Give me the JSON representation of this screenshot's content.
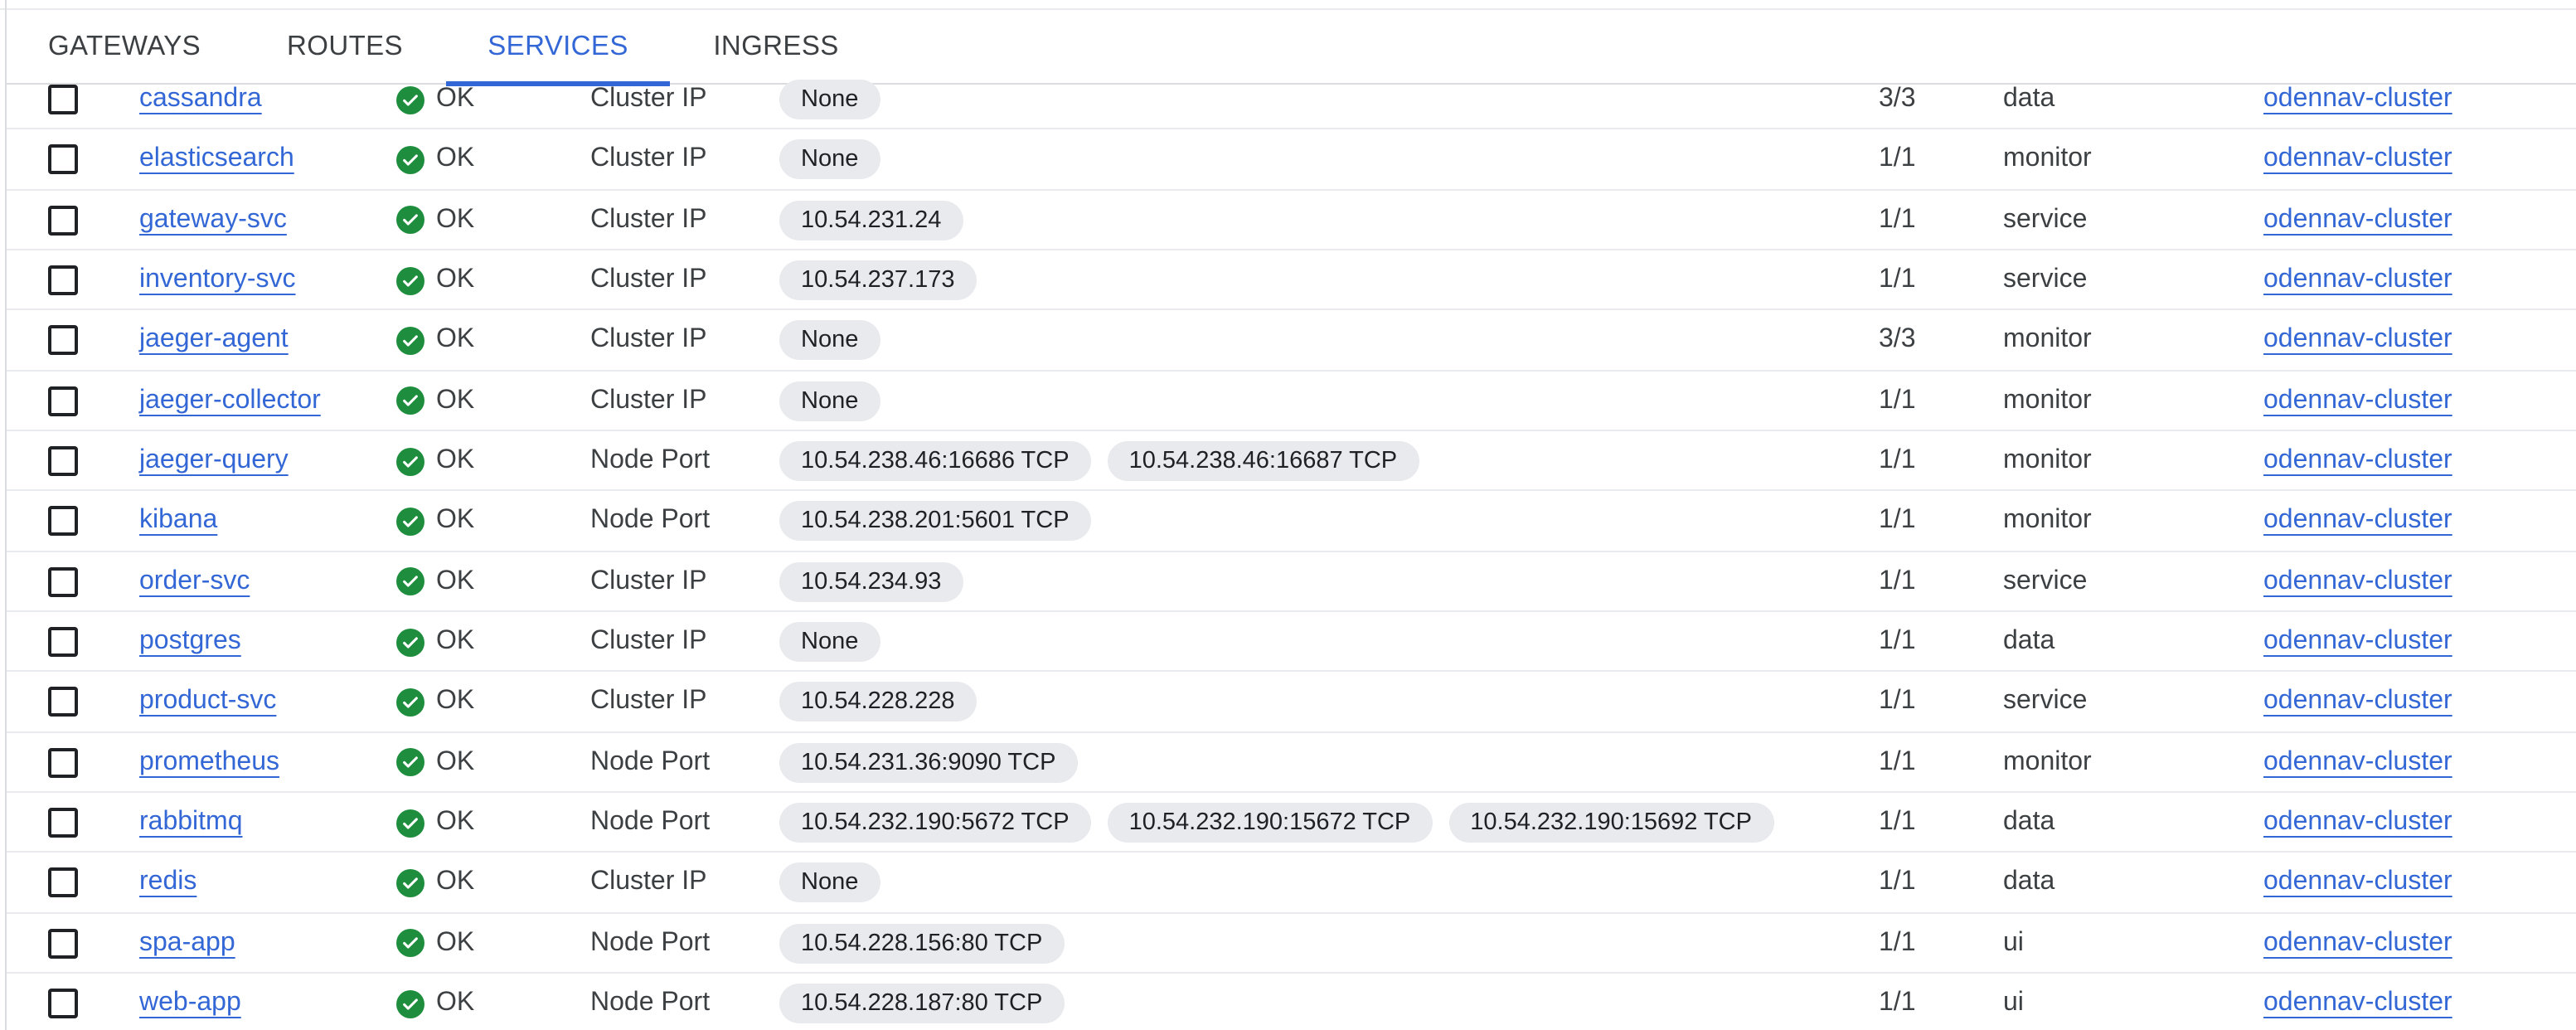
{
  "tabs": [
    {
      "label": "GATEWAYS",
      "active": false
    },
    {
      "label": "ROUTES",
      "active": false
    },
    {
      "label": "SERVICES",
      "active": true
    },
    {
      "label": "INGRESS",
      "active": false
    }
  ],
  "colors": {
    "accent": "#3367d6",
    "ok_green": "#1e8e3e",
    "chip_bg": "#e8eaed"
  },
  "icons": {
    "status_ok": "check-circle-icon"
  },
  "services": [
    {
      "name": "cassandra",
      "status": "OK",
      "type": "Cluster IP",
      "endpoints": [
        "None"
      ],
      "pods": "3/3",
      "namespace": "data",
      "cluster": "odennav-cluster"
    },
    {
      "name": "elasticsearch",
      "status": "OK",
      "type": "Cluster IP",
      "endpoints": [
        "None"
      ],
      "pods": "1/1",
      "namespace": "monitor",
      "cluster": "odennav-cluster"
    },
    {
      "name": "gateway-svc",
      "status": "OK",
      "type": "Cluster IP",
      "endpoints": [
        "10.54.231.24"
      ],
      "pods": "1/1",
      "namespace": "service",
      "cluster": "odennav-cluster"
    },
    {
      "name": "inventory-svc",
      "status": "OK",
      "type": "Cluster IP",
      "endpoints": [
        "10.54.237.173"
      ],
      "pods": "1/1",
      "namespace": "service",
      "cluster": "odennav-cluster"
    },
    {
      "name": "jaeger-agent",
      "status": "OK",
      "type": "Cluster IP",
      "endpoints": [
        "None"
      ],
      "pods": "3/3",
      "namespace": "monitor",
      "cluster": "odennav-cluster"
    },
    {
      "name": "jaeger-collector",
      "status": "OK",
      "type": "Cluster IP",
      "endpoints": [
        "None"
      ],
      "pods": "1/1",
      "namespace": "monitor",
      "cluster": "odennav-cluster"
    },
    {
      "name": "jaeger-query",
      "status": "OK",
      "type": "Node Port",
      "endpoints": [
        "10.54.238.46:16686 TCP",
        "10.54.238.46:16687 TCP"
      ],
      "pods": "1/1",
      "namespace": "monitor",
      "cluster": "odennav-cluster"
    },
    {
      "name": "kibana",
      "status": "OK",
      "type": "Node Port",
      "endpoints": [
        "10.54.238.201:5601 TCP"
      ],
      "pods": "1/1",
      "namespace": "monitor",
      "cluster": "odennav-cluster"
    },
    {
      "name": "order-svc",
      "status": "OK",
      "type": "Cluster IP",
      "endpoints": [
        "10.54.234.93"
      ],
      "pods": "1/1",
      "namespace": "service",
      "cluster": "odennav-cluster"
    },
    {
      "name": "postgres",
      "status": "OK",
      "type": "Cluster IP",
      "endpoints": [
        "None"
      ],
      "pods": "1/1",
      "namespace": "data",
      "cluster": "odennav-cluster"
    },
    {
      "name": "product-svc",
      "status": "OK",
      "type": "Cluster IP",
      "endpoints": [
        "10.54.228.228"
      ],
      "pods": "1/1",
      "namespace": "service",
      "cluster": "odennav-cluster"
    },
    {
      "name": "prometheus",
      "status": "OK",
      "type": "Node Port",
      "endpoints": [
        "10.54.231.36:9090 TCP"
      ],
      "pods": "1/1",
      "namespace": "monitor",
      "cluster": "odennav-cluster"
    },
    {
      "name": "rabbitmq",
      "status": "OK",
      "type": "Node Port",
      "endpoints": [
        "10.54.232.190:5672 TCP",
        "10.54.232.190:15672 TCP",
        "10.54.232.190:15692 TCP"
      ],
      "pods": "1/1",
      "namespace": "data",
      "cluster": "odennav-cluster"
    },
    {
      "name": "redis",
      "status": "OK",
      "type": "Cluster IP",
      "endpoints": [
        "None"
      ],
      "pods": "1/1",
      "namespace": "data",
      "cluster": "odennav-cluster"
    },
    {
      "name": "spa-app",
      "status": "OK",
      "type": "Node Port",
      "endpoints": [
        "10.54.228.156:80 TCP"
      ],
      "pods": "1/1",
      "namespace": "ui",
      "cluster": "odennav-cluster"
    },
    {
      "name": "web-app",
      "status": "OK",
      "type": "Node Port",
      "endpoints": [
        "10.54.228.187:80 TCP"
      ],
      "pods": "1/1",
      "namespace": "ui",
      "cluster": "odennav-cluster"
    }
  ]
}
